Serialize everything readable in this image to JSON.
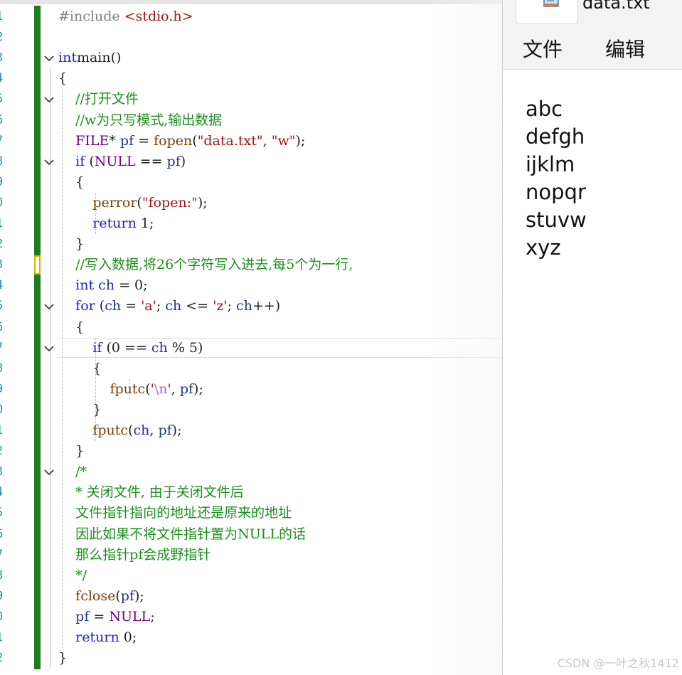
{
  "editor": {
    "line_numbers": [
      "1",
      "2",
      "3",
      "4",
      "5",
      "6",
      "7",
      "8",
      "9",
      "0",
      "1",
      "2",
      "3",
      "4",
      "5",
      "6",
      "7",
      "8",
      "9",
      "0",
      "1",
      "2",
      "3",
      "4",
      "5",
      "6",
      "7",
      "8",
      "9",
      "0",
      "1",
      "2"
    ],
    "lines": [
      [
        [
          "pp",
          "#include "
        ],
        [
          "st",
          "<stdio.h>"
        ]
      ],
      [],
      [
        [
          "kw",
          "int"
        ],
        [
          "",
          "main()"
        ]
      ],
      [
        [
          "",
          "{"
        ]
      ],
      [
        [
          "",
          "    "
        ],
        [
          "cm",
          "//打开文件"
        ]
      ],
      [
        [
          "",
          "    "
        ],
        [
          "cm",
          "//w为只写模式,输出数据"
        ]
      ],
      [
        [
          "",
          "    "
        ],
        [
          "mc",
          "FILE"
        ],
        [
          "",
          "* "
        ],
        [
          "id",
          "pf"
        ],
        [
          "",
          " = "
        ],
        [
          "fn",
          "fopen"
        ],
        [
          "",
          "("
        ],
        [
          "st",
          "\"data.txt\""
        ],
        [
          "",
          ", "
        ],
        [
          "st",
          "\"w\""
        ],
        [
          "",
          ");"
        ]
      ],
      [
        [
          "",
          "    "
        ],
        [
          "kw",
          "if"
        ],
        [
          "",
          " ("
        ],
        [
          "mc",
          "NULL"
        ],
        [
          "",
          " == "
        ],
        [
          "id",
          "pf"
        ],
        [
          "",
          ")"
        ]
      ],
      [
        [
          "",
          "    {"
        ]
      ],
      [
        [
          "",
          "        "
        ],
        [
          "fn",
          "perror"
        ],
        [
          "",
          "("
        ],
        [
          "st",
          "\"fopen:\""
        ],
        [
          "",
          ");"
        ]
      ],
      [
        [
          "",
          "        "
        ],
        [
          "kw",
          "return"
        ],
        [
          "",
          " 1;"
        ]
      ],
      [
        [
          "",
          "    }"
        ]
      ],
      [
        [
          "",
          "    "
        ],
        [
          "cm",
          "//写入数据,将26个字符写入进去,每5个为一行,"
        ]
      ],
      [
        [
          "",
          "    "
        ],
        [
          "kw",
          "int"
        ],
        [
          "",
          " "
        ],
        [
          "id",
          "ch"
        ],
        [
          "",
          " = 0;"
        ]
      ],
      [
        [
          "",
          "    "
        ],
        [
          "kw",
          "for"
        ],
        [
          "",
          " ("
        ],
        [
          "id",
          "ch"
        ],
        [
          "",
          " = "
        ],
        [
          "st",
          "'a'"
        ],
        [
          "",
          "; "
        ],
        [
          "id",
          "ch"
        ],
        [
          "",
          " <= "
        ],
        [
          "st",
          "'z'"
        ],
        [
          "",
          "; "
        ],
        [
          "id",
          "ch"
        ],
        [
          "",
          "++)"
        ]
      ],
      [
        [
          "",
          "    {"
        ]
      ],
      [
        [
          "",
          "        "
        ],
        [
          "kw",
          "if"
        ],
        [
          "",
          " (0 == "
        ],
        [
          "id",
          "ch"
        ],
        [
          "",
          " % 5)"
        ]
      ],
      [
        [
          "",
          "        {"
        ]
      ],
      [
        [
          "",
          "            "
        ],
        [
          "fn",
          "fputc"
        ],
        [
          "",
          "("
        ],
        [
          "st",
          "'"
        ],
        [
          "esc",
          "\\n"
        ],
        [
          "st",
          "'"
        ],
        [
          "",
          ", "
        ],
        [
          "id",
          "pf"
        ],
        [
          "",
          ");"
        ]
      ],
      [
        [
          "",
          "        }"
        ]
      ],
      [
        [
          "",
          "        "
        ],
        [
          "fn",
          "fputc"
        ],
        [
          "",
          "("
        ],
        [
          "id",
          "ch"
        ],
        [
          "",
          ", "
        ],
        [
          "id",
          "pf"
        ],
        [
          "",
          ");"
        ]
      ],
      [
        [
          "",
          "    }"
        ]
      ],
      [
        [
          "",
          "    "
        ],
        [
          "cm",
          "/*"
        ]
      ],
      [
        [
          "",
          "    "
        ],
        [
          "cm",
          "* 关闭文件, 由于关闭文件后"
        ]
      ],
      [
        [
          "",
          "    "
        ],
        [
          "cm",
          "文件指针指向的地址还是原来的地址"
        ]
      ],
      [
        [
          "",
          "    "
        ],
        [
          "cm",
          "因此如果不将文件指针置为NULL的话"
        ]
      ],
      [
        [
          "",
          "    "
        ],
        [
          "cm",
          "那么指针pf会成野指针"
        ]
      ],
      [
        [
          "",
          "    "
        ],
        [
          "cm",
          "*/"
        ]
      ],
      [
        [
          "",
          "    "
        ],
        [
          "fn",
          "fclose"
        ],
        [
          "",
          "("
        ],
        [
          "id",
          "pf"
        ],
        [
          "",
          ");"
        ]
      ],
      [
        [
          "",
          "    "
        ],
        [
          "id",
          "pf"
        ],
        [
          "",
          " = "
        ],
        [
          "mc",
          "NULL"
        ],
        [
          "",
          ";"
        ]
      ],
      [
        [
          "",
          "    "
        ],
        [
          "kw",
          "return"
        ],
        [
          "",
          " 0;"
        ]
      ],
      [
        [
          "",
          "}"
        ]
      ]
    ],
    "colors": {
      "keyword": "#1f1fd6",
      "comment": "#1a8f1a",
      "string": "#a31515",
      "macro": "#6f008a",
      "function": "#7a3e00",
      "change_bar": "#1e7d1e",
      "line_number": "#2b91af"
    }
  },
  "notepad": {
    "title": "data.txt",
    "menu": [
      "文件",
      "编辑"
    ],
    "content": [
      "abc",
      "defgh",
      "ijklm",
      "nopqr",
      "stuvw",
      "xyz"
    ]
  },
  "watermark": "CSDN @一叶之秋1412"
}
